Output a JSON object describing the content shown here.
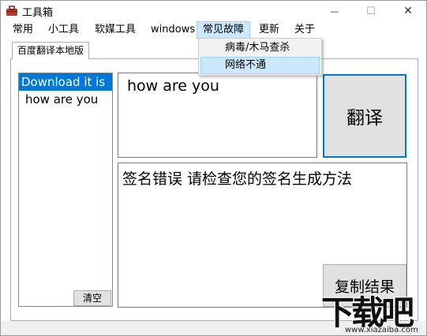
{
  "window": {
    "title": "工具箱",
    "controls": {
      "minimize": "—",
      "maximize": "☐",
      "close": "✕"
    }
  },
  "menubar": {
    "items": [
      {
        "label": "常用"
      },
      {
        "label": "小工具"
      },
      {
        "label": "软媒工具"
      },
      {
        "label": "windows"
      },
      {
        "label": "常见故障",
        "active": true
      },
      {
        "label": "更新"
      },
      {
        "label": "关于"
      }
    ]
  },
  "dropdown": {
    "items": [
      {
        "label": "病毒/木马查杀"
      },
      {
        "label": "网络不通",
        "hovered": true
      }
    ]
  },
  "tab": {
    "label": "百度翻译本地版"
  },
  "history": {
    "items": [
      {
        "text": "Download it is",
        "selected": true
      },
      {
        "text": "how are you",
        "selected": false
      }
    ],
    "clear_label": "清空"
  },
  "input": {
    "value": "how are you"
  },
  "translate_label": "翻译",
  "output": {
    "value": "签名错误   请检查您的签名生成方法"
  },
  "copy_label": "复制结果",
  "watermark": {
    "main": "下载吧",
    "sub": "www.xiazaiba.com"
  },
  "colors": {
    "accent": "#0078d7",
    "menu_highlight": "#cce8ff"
  }
}
